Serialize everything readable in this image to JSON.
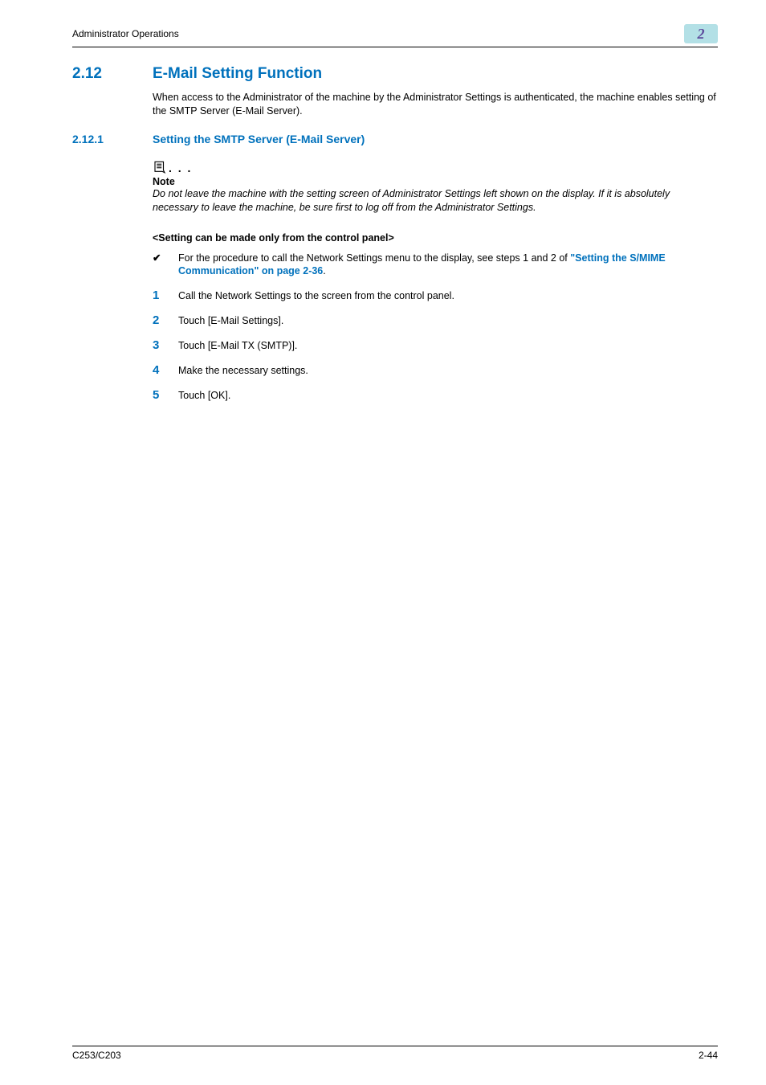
{
  "header": {
    "running_head": "Administrator Operations",
    "chapter_number": "2"
  },
  "section": {
    "number": "2.12",
    "title": "E-Mail Setting Function",
    "intro": "When access to the Administrator of the machine by the Administrator Settings is authenticated, the machine enables setting of the SMTP Server (E-Mail Server)."
  },
  "subsection": {
    "number": "2.12.1",
    "title": "Setting the SMTP Server (E-Mail Server)"
  },
  "note": {
    "dots": ". . .",
    "label": "Note",
    "text": "Do not leave the machine with the setting screen of Administrator Settings left shown on the display. If it is absolutely necessary to leave the machine, be sure first to log off from the Administrator Settings."
  },
  "subhead": "<Setting can be made only from the control panel>",
  "bullet": {
    "marker": "✔",
    "text_prefix": "For the procedure to call the Network Settings menu to the display, see steps 1 and 2 of ",
    "link_text": "\"Setting the S/MIME Communication\" on page 2-36",
    "text_suffix": "."
  },
  "steps": [
    {
      "n": "1",
      "text": "Call the Network Settings to the screen from the control panel."
    },
    {
      "n": "2",
      "text": "Touch [E-Mail Settings]."
    },
    {
      "n": "3",
      "text": "Touch [E-Mail TX (SMTP)]."
    },
    {
      "n": "4",
      "text": "Make the necessary settings."
    },
    {
      "n": "5",
      "text": "Touch [OK]."
    }
  ],
  "footer": {
    "left": "C253/C203",
    "right": "2-44"
  }
}
